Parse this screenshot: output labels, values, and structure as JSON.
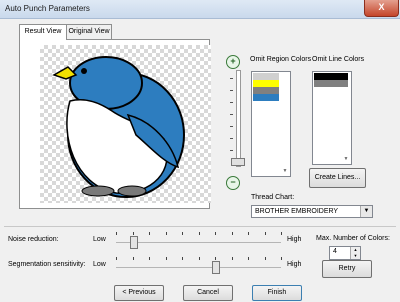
{
  "window": {
    "title": "Auto Punch Parameters",
    "close_glyph": "X"
  },
  "tabs": [
    {
      "label": "Result View"
    },
    {
      "label": "Original View"
    }
  ],
  "zoom": {
    "in_glyph": "+",
    "out_glyph": "−"
  },
  "omit_region": {
    "label": "Omit Region Colors",
    "colors": [
      "#d0d0d0",
      "#ffff00",
      "#808080",
      "#2d7dbf"
    ]
  },
  "omit_line": {
    "label": "Omit Line Colors",
    "colors": [
      "#000000",
      "#808080"
    ]
  },
  "create_lines_label": "Create Lines...",
  "thread_chart": {
    "label": "Thread Chart:",
    "value": "BROTHER EMBROIDERY"
  },
  "noise": {
    "label": "Noise reduction:",
    "low": "Low",
    "high": "High",
    "level": 0.1
  },
  "segmentation": {
    "label": "Segmentation sensitivity:",
    "low": "Low",
    "high": "High",
    "level": 0.6
  },
  "max_colors": {
    "label": "Max. Number of Colors:",
    "value": "4"
  },
  "retry_label": "Retry",
  "footer": {
    "previous": "< Previous",
    "cancel": "Cancel",
    "finish": "Finish"
  }
}
